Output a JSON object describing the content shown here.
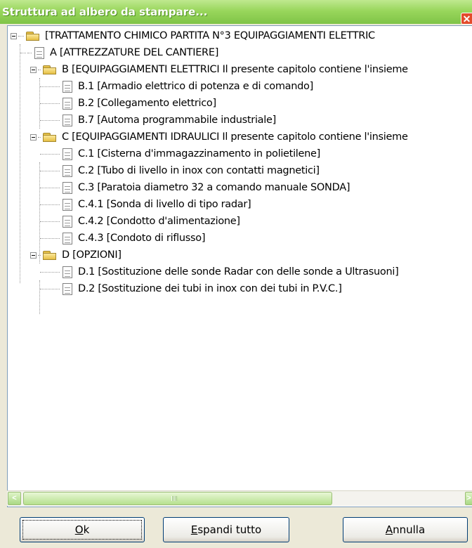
{
  "window": {
    "title": "Struttura ad albero da stampare...",
    "close_glyph": "✕"
  },
  "tree": [
    {
      "label": "[TRATTAMENTO CHIMICO   PARTITA N°3  EQUIPAGGIAMENTI ELETTRIC",
      "icon": "folder-open-icon",
      "expander": true
    },
    {
      "label": "A [ATTREZZATURE DEL CANTIERE]",
      "icon": "document-icon"
    },
    {
      "label": "B [EQUIPAGGIAMENTI ELETTRICI    Il presente capitolo contiene l'insieme",
      "icon": "folder-open-icon",
      "expander": true
    },
    {
      "label": "B.1 [Armadio elettrico di potenza e di comando]",
      "icon": "document-icon"
    },
    {
      "label": "B.2 [Collegamento elettrico]",
      "icon": "document-icon"
    },
    {
      "label": "B.7 [Automa programmabile industriale]",
      "icon": "document-icon"
    },
    {
      "label": "C [EQUIPAGGIAMENTI IDRAULICI    Il presente capitolo contiene l'insieme",
      "icon": "folder-open-icon",
      "expander": true
    },
    {
      "label": "C.1 [Cisterna d'immagazzinamento in polietilene]",
      "icon": "document-icon"
    },
    {
      "label": "C.2 [Tubo di livello in inox con contatti magnetici]",
      "icon": "document-icon"
    },
    {
      "label": "C.3 [Paratoia diametro 32 a comando manuale    SONDA]",
      "icon": "document-icon"
    },
    {
      "label": "C.4.1 [Sonda di livello di tipo radar]",
      "icon": "document-icon"
    },
    {
      "label": "C.4.2 [Condotto d'alimentazione]",
      "icon": "document-icon"
    },
    {
      "label": "C.4.3 [Condoto di riflusso]",
      "icon": "document-icon"
    },
    {
      "label": "D [OPZIONI]",
      "icon": "folder-open-icon",
      "expander": true
    },
    {
      "label": "D.1 [Sostituzione delle sonde Radar con delle sonde a Ultrasuoni]",
      "icon": "document-icon"
    },
    {
      "label": "D.2 [Sostituzione dei tubi in inox con dei tubi in P.V.C.]",
      "icon": "document-icon"
    }
  ],
  "buttons": {
    "ok": {
      "accel": "O",
      "rest": "k"
    },
    "expand": {
      "accel": "E",
      "rest": "spandi tutto"
    },
    "cancel": {
      "accel": "A",
      "rest": "nnulla"
    }
  },
  "scrollbar": {
    "left_glyph": "<",
    "right_glyph": ">"
  }
}
